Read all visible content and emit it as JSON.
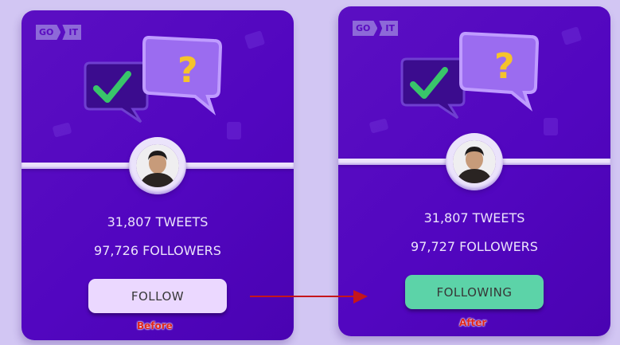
{
  "logo": {
    "part1": "GO",
    "part2": "IT"
  },
  "cards": {
    "before": {
      "tweets": "31,807 TWEETS",
      "followers": "97,726 FOLLOWERS",
      "button_label": "FOLLOW",
      "caption": "Before"
    },
    "after": {
      "tweets": "31,807 TWEETS",
      "followers": "97,727 FOLLOWERS",
      "button_label": "FOLLOWING",
      "caption": "After"
    }
  },
  "colors": {
    "page_bg": "#d2c6f3",
    "card_bg": "#5206c0",
    "follow_button": "#ebd8ff",
    "following_button": "#5cd3a8",
    "caption": "#e0241a",
    "arrow": "#c5161c"
  },
  "icons": {
    "checkmark": "checkmark-bubble-icon",
    "question": "question-bubble-icon",
    "arrow": "right-arrow-icon"
  }
}
